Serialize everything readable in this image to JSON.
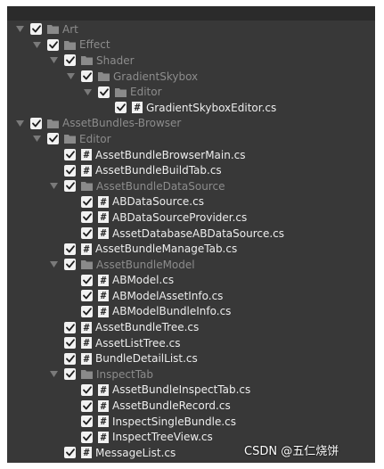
{
  "tree": {
    "items": [
      {
        "label": "Art",
        "depth": 0,
        "kind": "folder",
        "expanded": true,
        "checked": true,
        "dim": true
      },
      {
        "label": "Effect",
        "depth": 1,
        "kind": "folder",
        "expanded": true,
        "checked": true,
        "dim": true
      },
      {
        "label": "Shader",
        "depth": 2,
        "kind": "folder",
        "expanded": true,
        "checked": true,
        "dim": true
      },
      {
        "label": "GradientSkybox",
        "depth": 3,
        "kind": "folder",
        "expanded": true,
        "checked": true,
        "dim": true
      },
      {
        "label": "Editor",
        "depth": 4,
        "kind": "folder",
        "expanded": true,
        "checked": true,
        "dim": true
      },
      {
        "label": "GradientSkyboxEditor.cs",
        "depth": 5,
        "kind": "file",
        "checked": true,
        "dim": false
      },
      {
        "label": "AssetBundles-Browser",
        "depth": 0,
        "kind": "folder",
        "expanded": true,
        "checked": true,
        "dim": true
      },
      {
        "label": "Editor",
        "depth": 1,
        "kind": "folder",
        "expanded": true,
        "checked": true,
        "dim": true
      },
      {
        "label": "AssetBundleBrowserMain.cs",
        "depth": 2,
        "kind": "file",
        "checked": true,
        "dim": false
      },
      {
        "label": "AssetBundleBuildTab.cs",
        "depth": 2,
        "kind": "file",
        "checked": true,
        "dim": false
      },
      {
        "label": "AssetBundleDataSource",
        "depth": 2,
        "kind": "folder",
        "expanded": true,
        "checked": true,
        "dim": true
      },
      {
        "label": "ABDataSource.cs",
        "depth": 3,
        "kind": "file",
        "checked": true,
        "dim": false
      },
      {
        "label": "ABDataSourceProvider.cs",
        "depth": 3,
        "kind": "file",
        "checked": true,
        "dim": false
      },
      {
        "label": "AssetDatabaseABDataSource.cs",
        "depth": 3,
        "kind": "file",
        "checked": true,
        "dim": false
      },
      {
        "label": "AssetBundleManageTab.cs",
        "depth": 2,
        "kind": "file",
        "checked": true,
        "dim": false
      },
      {
        "label": "AssetBundleModel",
        "depth": 2,
        "kind": "folder",
        "expanded": true,
        "checked": true,
        "dim": true
      },
      {
        "label": "ABModel.cs",
        "depth": 3,
        "kind": "file",
        "checked": true,
        "dim": false
      },
      {
        "label": "ABModelAssetInfo.cs",
        "depth": 3,
        "kind": "file",
        "checked": true,
        "dim": false
      },
      {
        "label": "ABModelBundleInfo.cs",
        "depth": 3,
        "kind": "file",
        "checked": true,
        "dim": false
      },
      {
        "label": "AssetBundleTree.cs",
        "depth": 2,
        "kind": "file",
        "checked": true,
        "dim": false
      },
      {
        "label": "AssetListTree.cs",
        "depth": 2,
        "kind": "file",
        "checked": true,
        "dim": false
      },
      {
        "label": "BundleDetailList.cs",
        "depth": 2,
        "kind": "file",
        "checked": true,
        "dim": false
      },
      {
        "label": "InspectTab",
        "depth": 2,
        "kind": "folder",
        "expanded": true,
        "checked": true,
        "dim": true
      },
      {
        "label": "AssetBundleInspectTab.cs",
        "depth": 3,
        "kind": "file",
        "checked": true,
        "dim": false
      },
      {
        "label": "AssetBundleRecord.cs",
        "depth": 3,
        "kind": "file",
        "checked": true,
        "dim": false
      },
      {
        "label": "InspectSingleBundle.cs",
        "depth": 3,
        "kind": "file",
        "checked": true,
        "dim": false
      },
      {
        "label": "InspectTreeView.cs",
        "depth": 3,
        "kind": "file",
        "checked": true,
        "dim": false
      },
      {
        "label": "MessageList.cs",
        "depth": 2,
        "kind": "file",
        "checked": true,
        "dim": false
      }
    ]
  },
  "icons": {
    "expand": "chevron-down-icon",
    "checkbox": "checkmark-icon",
    "folder": "folder-icon",
    "script": "csharp-script-icon",
    "script_glyph": "#"
  },
  "colors": {
    "panel_bg": "#383838",
    "text": "#e8e8e8",
    "dim_text": "#8c8c8c",
    "checkbox": "#f2f2f2"
  },
  "watermark": "CSDN @五仁烧饼"
}
